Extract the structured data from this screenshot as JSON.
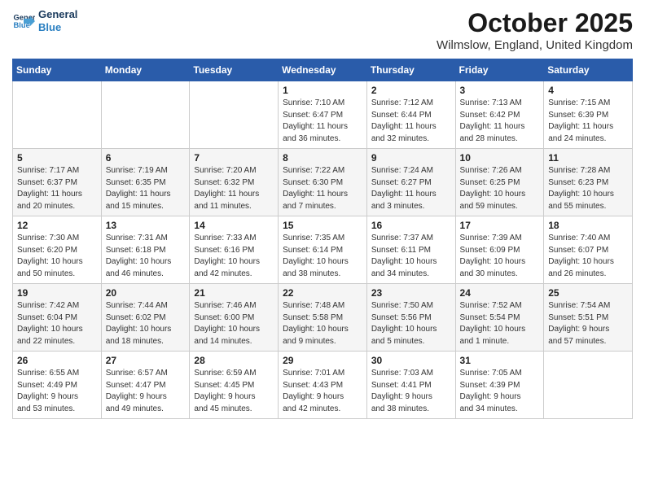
{
  "header": {
    "logo_line1": "General",
    "logo_line2": "Blue",
    "month": "October 2025",
    "location": "Wilmslow, England, United Kingdom"
  },
  "days_of_week": [
    "Sunday",
    "Monday",
    "Tuesday",
    "Wednesday",
    "Thursday",
    "Friday",
    "Saturday"
  ],
  "weeks": [
    [
      {
        "day": "",
        "info": ""
      },
      {
        "day": "",
        "info": ""
      },
      {
        "day": "",
        "info": ""
      },
      {
        "day": "1",
        "info": "Sunrise: 7:10 AM\nSunset: 6:47 PM\nDaylight: 11 hours\nand 36 minutes."
      },
      {
        "day": "2",
        "info": "Sunrise: 7:12 AM\nSunset: 6:44 PM\nDaylight: 11 hours\nand 32 minutes."
      },
      {
        "day": "3",
        "info": "Sunrise: 7:13 AM\nSunset: 6:42 PM\nDaylight: 11 hours\nand 28 minutes."
      },
      {
        "day": "4",
        "info": "Sunrise: 7:15 AM\nSunset: 6:39 PM\nDaylight: 11 hours\nand 24 minutes."
      }
    ],
    [
      {
        "day": "5",
        "info": "Sunrise: 7:17 AM\nSunset: 6:37 PM\nDaylight: 11 hours\nand 20 minutes."
      },
      {
        "day": "6",
        "info": "Sunrise: 7:19 AM\nSunset: 6:35 PM\nDaylight: 11 hours\nand 15 minutes."
      },
      {
        "day": "7",
        "info": "Sunrise: 7:20 AM\nSunset: 6:32 PM\nDaylight: 11 hours\nand 11 minutes."
      },
      {
        "day": "8",
        "info": "Sunrise: 7:22 AM\nSunset: 6:30 PM\nDaylight: 11 hours\nand 7 minutes."
      },
      {
        "day": "9",
        "info": "Sunrise: 7:24 AM\nSunset: 6:27 PM\nDaylight: 11 hours\nand 3 minutes."
      },
      {
        "day": "10",
        "info": "Sunrise: 7:26 AM\nSunset: 6:25 PM\nDaylight: 10 hours\nand 59 minutes."
      },
      {
        "day": "11",
        "info": "Sunrise: 7:28 AM\nSunset: 6:23 PM\nDaylight: 10 hours\nand 55 minutes."
      }
    ],
    [
      {
        "day": "12",
        "info": "Sunrise: 7:30 AM\nSunset: 6:20 PM\nDaylight: 10 hours\nand 50 minutes."
      },
      {
        "day": "13",
        "info": "Sunrise: 7:31 AM\nSunset: 6:18 PM\nDaylight: 10 hours\nand 46 minutes."
      },
      {
        "day": "14",
        "info": "Sunrise: 7:33 AM\nSunset: 6:16 PM\nDaylight: 10 hours\nand 42 minutes."
      },
      {
        "day": "15",
        "info": "Sunrise: 7:35 AM\nSunset: 6:14 PM\nDaylight: 10 hours\nand 38 minutes."
      },
      {
        "day": "16",
        "info": "Sunrise: 7:37 AM\nSunset: 6:11 PM\nDaylight: 10 hours\nand 34 minutes."
      },
      {
        "day": "17",
        "info": "Sunrise: 7:39 AM\nSunset: 6:09 PM\nDaylight: 10 hours\nand 30 minutes."
      },
      {
        "day": "18",
        "info": "Sunrise: 7:40 AM\nSunset: 6:07 PM\nDaylight: 10 hours\nand 26 minutes."
      }
    ],
    [
      {
        "day": "19",
        "info": "Sunrise: 7:42 AM\nSunset: 6:04 PM\nDaylight: 10 hours\nand 22 minutes."
      },
      {
        "day": "20",
        "info": "Sunrise: 7:44 AM\nSunset: 6:02 PM\nDaylight: 10 hours\nand 18 minutes."
      },
      {
        "day": "21",
        "info": "Sunrise: 7:46 AM\nSunset: 6:00 PM\nDaylight: 10 hours\nand 14 minutes."
      },
      {
        "day": "22",
        "info": "Sunrise: 7:48 AM\nSunset: 5:58 PM\nDaylight: 10 hours\nand 9 minutes."
      },
      {
        "day": "23",
        "info": "Sunrise: 7:50 AM\nSunset: 5:56 PM\nDaylight: 10 hours\nand 5 minutes."
      },
      {
        "day": "24",
        "info": "Sunrise: 7:52 AM\nSunset: 5:54 PM\nDaylight: 10 hours\nand 1 minute."
      },
      {
        "day": "25",
        "info": "Sunrise: 7:54 AM\nSunset: 5:51 PM\nDaylight: 9 hours\nand 57 minutes."
      }
    ],
    [
      {
        "day": "26",
        "info": "Sunrise: 6:55 AM\nSunset: 4:49 PM\nDaylight: 9 hours\nand 53 minutes."
      },
      {
        "day": "27",
        "info": "Sunrise: 6:57 AM\nSunset: 4:47 PM\nDaylight: 9 hours\nand 49 minutes."
      },
      {
        "day": "28",
        "info": "Sunrise: 6:59 AM\nSunset: 4:45 PM\nDaylight: 9 hours\nand 45 minutes."
      },
      {
        "day": "29",
        "info": "Sunrise: 7:01 AM\nSunset: 4:43 PM\nDaylight: 9 hours\nand 42 minutes."
      },
      {
        "day": "30",
        "info": "Sunrise: 7:03 AM\nSunset: 4:41 PM\nDaylight: 9 hours\nand 38 minutes."
      },
      {
        "day": "31",
        "info": "Sunrise: 7:05 AM\nSunset: 4:39 PM\nDaylight: 9 hours\nand 34 minutes."
      },
      {
        "day": "",
        "info": ""
      }
    ]
  ]
}
